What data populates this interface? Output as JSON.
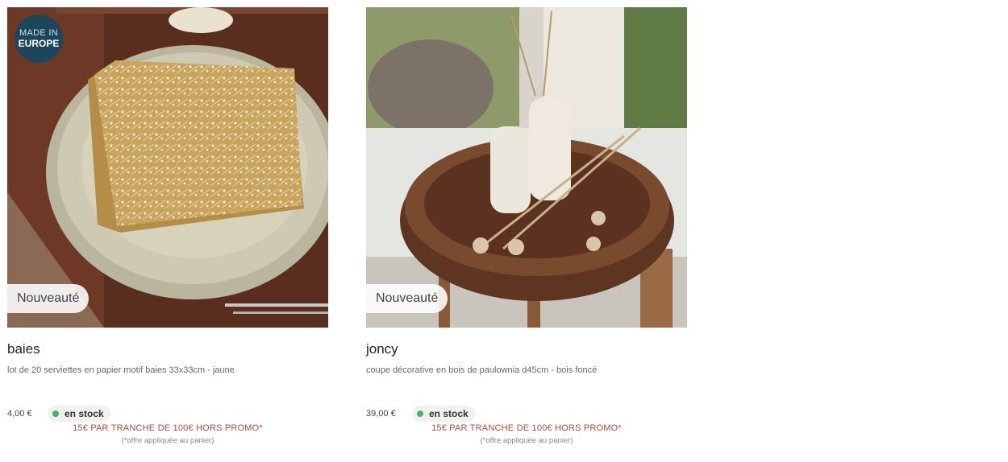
{
  "products": [
    {
      "origin_badge": {
        "line1": "MADE IN",
        "line2": "EUROPE"
      },
      "new_label": "Nouveauté",
      "name": "baies",
      "description": "lot de 20 serviettes en papier motif baies 33x33cm - jaune",
      "price": "4,00 €",
      "stock": "en stock",
      "promo": "15€ PAR TRANCHE DE 100€ HORS PROMO*",
      "promo_note": "(*offre appliquée au panier)"
    },
    {
      "new_label": "Nouveauté",
      "name": "joncy",
      "description": "coupe décorative en bois de paulownia d45cm - bois foncé",
      "price": "39,00 €",
      "stock": "en stock",
      "promo": "15€ PAR TRANCHE DE 100€ HORS PROMO*",
      "promo_note": "(*offre appliquée au panier)"
    }
  ],
  "colors": {
    "origin_badge": "#1c4659",
    "stock_dot": "#4caf6a",
    "promo_text": "#b34a3f"
  }
}
